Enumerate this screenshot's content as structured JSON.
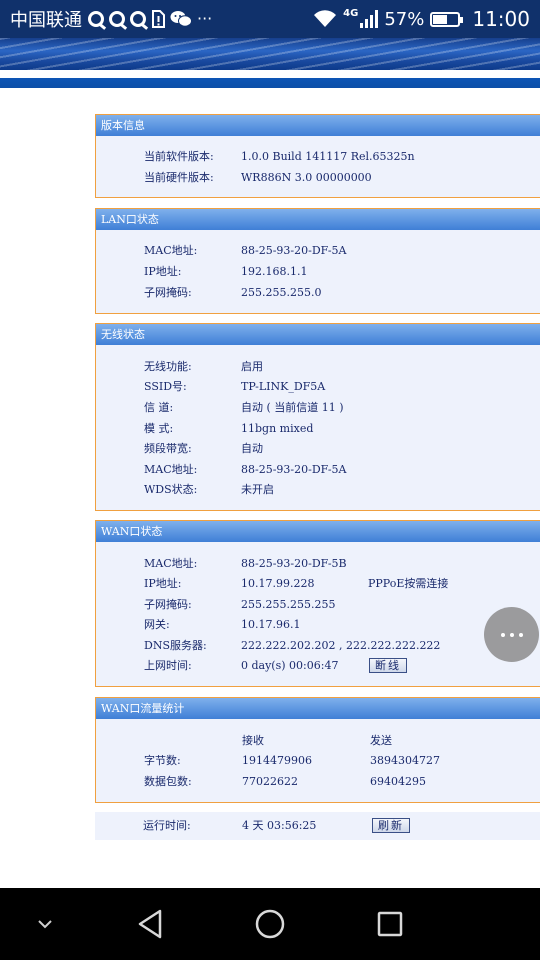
{
  "status_bar": {
    "carrier": "中国联通",
    "network": "4G",
    "battery": "57%",
    "battery_level": 0.57,
    "more": "···",
    "time": "11:00"
  },
  "sections": {
    "version": {
      "title": "版本信息",
      "rows": [
        {
          "label": "当前软件版本:",
          "value": "1.0.0 Build 141117 Rel.65325n"
        },
        {
          "label": "当前硬件版本:",
          "value": "WR886N 3.0 00000000"
        }
      ]
    },
    "lan": {
      "title": "LAN口状态",
      "rows": [
        {
          "label": "MAC地址:",
          "value": "88-25-93-20-DF-5A"
        },
        {
          "label": "IP地址:",
          "value": "192.168.1.1"
        },
        {
          "label": "子网掩码:",
          "value": "255.255.255.0"
        }
      ]
    },
    "wireless": {
      "title": "无线状态",
      "rows": [
        {
          "label": "无线功能:",
          "value": "启用"
        },
        {
          "label": "SSID号:",
          "value": "TP-LINK_DF5A"
        },
        {
          "label": "信 道:",
          "value": "自动 ( 当前信道 11 )"
        },
        {
          "label": "模 式:",
          "value": "11bgn mixed"
        },
        {
          "label": "频段带宽:",
          "value": "自动"
        },
        {
          "label": "MAC地址:",
          "value": "88-25-93-20-DF-5A"
        },
        {
          "label": "WDS状态:",
          "value": "未开启"
        }
      ]
    },
    "wan": {
      "title": "WAN口状态",
      "rows": [
        {
          "label": "MAC地址:",
          "value": "88-25-93-20-DF-5B"
        },
        {
          "label": "IP地址:",
          "value": "10.17.99.228",
          "extra": "PPPoE按需连接"
        },
        {
          "label": "子网掩码:",
          "value": "255.255.255.255"
        },
        {
          "label": "网关:",
          "value": "10.17.96.1"
        },
        {
          "label": "DNS服务器:",
          "value": "222.222.202.202 , 222.222.222.222"
        },
        {
          "label": "上网时间:",
          "value": "0 day(s) 00:06:47"
        }
      ],
      "disconnect_button": "断线"
    },
    "traffic": {
      "title": "WAN口流量统计",
      "col_receive": "接收",
      "col_send": "发送",
      "rows": [
        {
          "label": "字节数:",
          "receive": "1914479906",
          "send": "3894304727"
        },
        {
          "label": "数据包数:",
          "receive": "77022622",
          "send": "69404295"
        }
      ]
    }
  },
  "footer": {
    "uptime_label": "运行时间:",
    "uptime_value": "4 天 03:56:25",
    "refresh_button": "刷新"
  },
  "icons": [
    "qq-icon",
    "qq-icon",
    "qq-icon",
    "sim-alert-icon",
    "wechat-icon",
    "wifi-icon",
    "signal-icon",
    "battery-icon",
    "more-icon",
    "back-icon",
    "home-icon",
    "recents-icon",
    "down-chevron-icon"
  ]
}
